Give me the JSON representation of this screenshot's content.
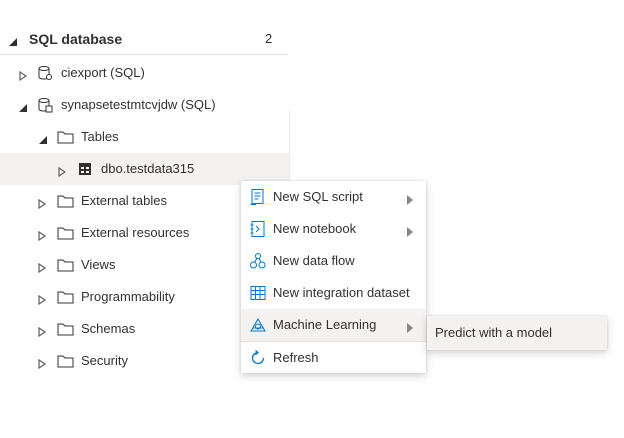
{
  "explorer": {
    "section_title": "SQL database",
    "section_count": "2",
    "rows": [
      {
        "label": "ciexport (SQL)"
      },
      {
        "label": "synapsetestmtcvjdw (SQL)"
      },
      {
        "label": "Tables"
      },
      {
        "label": "dbo.testdata315"
      },
      {
        "label": "External tables"
      },
      {
        "label": "External resources"
      },
      {
        "label": "Views"
      },
      {
        "label": "Programmability"
      },
      {
        "label": "Schemas"
      },
      {
        "label": "Security"
      }
    ]
  },
  "context_menu": {
    "items": [
      {
        "label": "New SQL script",
        "icon": "sql-script-icon",
        "has_submenu": true
      },
      {
        "label": "New notebook",
        "icon": "notebook-icon",
        "has_submenu": true
      },
      {
        "label": "New data flow",
        "icon": "data-flow-icon",
        "has_submenu": false
      },
      {
        "label": "New integration dataset",
        "icon": "dataset-icon",
        "has_submenu": false
      },
      {
        "label": "Machine Learning",
        "icon": "machine-learning-icon",
        "has_submenu": true,
        "active": true
      },
      {
        "label": "Refresh",
        "icon": "refresh-icon",
        "has_submenu": false
      }
    ]
  },
  "submenu": {
    "items": [
      {
        "label": "Predict with a model"
      }
    ]
  },
  "colors": {
    "accent": "#0078d4",
    "selected_bg": "#f3f2f1",
    "text": "#323130"
  }
}
